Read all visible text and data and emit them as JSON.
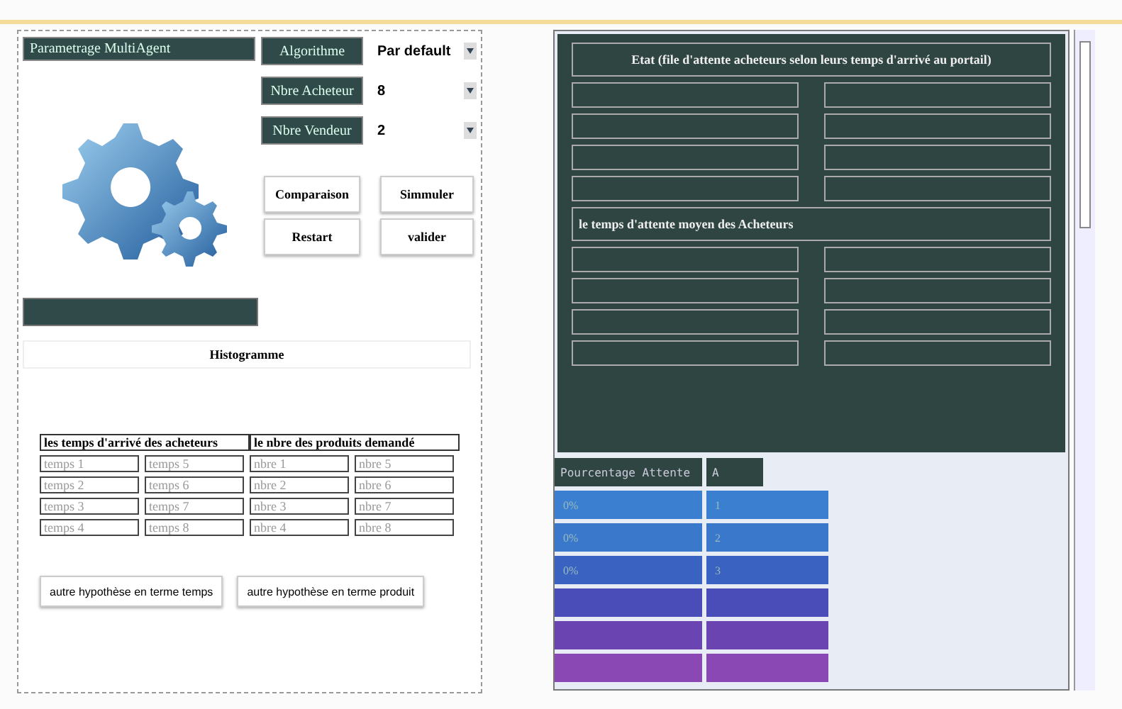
{
  "left_panel": {
    "title": "Parametrage MultiAgent",
    "settings": [
      {
        "label": "Algorithme",
        "value": "Par default"
      },
      {
        "label": "Nbre Acheteur",
        "value": "8"
      },
      {
        "label": "Nbre Vendeur",
        "value": "2"
      }
    ],
    "buttons": [
      "Comparaison",
      "Simmuler",
      "Restart",
      "valider"
    ],
    "histogram_button": "Histogramme",
    "table": {
      "columns": [
        "les temps d'arrivé des acheteurs",
        "le nbre des produits demandé"
      ],
      "rows": [
        {
          "placeholders": [
            "temps 1",
            "temps 5",
            "nbre 1",
            "nbre 5"
          ]
        },
        {
          "placeholders": [
            "temps 2",
            "temps 6",
            "nbre 2",
            "nbre 6"
          ]
        },
        {
          "placeholders": [
            "temps 3",
            "temps 7",
            "nbre 3",
            "nbre 7"
          ]
        },
        {
          "placeholders": [
            "temps 4",
            "temps 8",
            "nbre 4",
            "nbre 8"
          ]
        }
      ]
    },
    "hypothesis_buttons": [
      "autre hypothèse en terme temps",
      "autre hypothèse en terme produit"
    ]
  },
  "right_panel": {
    "sections": [
      {
        "title": "Etat (file d'attente  acheteurs selon leurs temps d'arrivé au portail)",
        "centered": true
      },
      {
        "title": "le temps d'attente moyen des Acheteurs",
        "centered": false
      }
    ],
    "table": {
      "columns": [
        "Pourcentage Attente",
        "A"
      ],
      "rows": [
        {
          "cells": [
            "0%",
            "1"
          ],
          "color": "#3a7fd0"
        },
        {
          "cells": [
            "0%",
            "2"
          ],
          "color": "#3a78cc"
        },
        {
          "cells": [
            "0%",
            "3"
          ],
          "color": "#3a62c0"
        },
        {
          "cells": [],
          "color": "#4a4cb8"
        },
        {
          "cells": [],
          "color": "#6a44b0"
        },
        {
          "cells": [],
          "color": "#8a48b4"
        }
      ]
    }
  }
}
